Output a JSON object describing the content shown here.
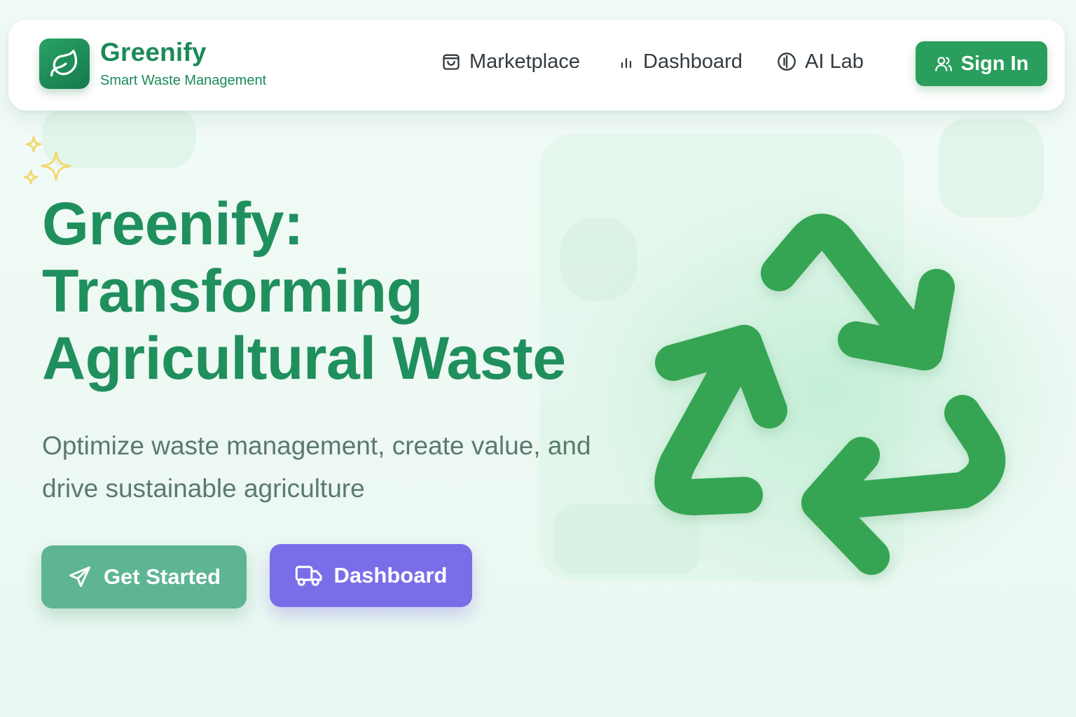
{
  "brand": {
    "name": "Greenify",
    "tagline": "Smart Waste Management",
    "logo_icon": "leaf-icon"
  },
  "nav": {
    "items": [
      {
        "label": "Marketplace",
        "icon": "shopping-bag-icon"
      },
      {
        "label": "Dashboard",
        "icon": "bar-chart-icon"
      },
      {
        "label": "AI Lab",
        "icon": "ai-circle-icon"
      }
    ],
    "signin": {
      "label": "Sign In",
      "icon": "users-icon"
    }
  },
  "hero": {
    "title_line1": "Greenify:",
    "title_line2": "Transforming",
    "title_line3": "Agricultural Waste",
    "subtitle_line1": "Optimize waste management, create value, and",
    "subtitle_line2": "drive sustainable agriculture",
    "primary_button": {
      "label": "Get Started",
      "icon": "send-icon"
    },
    "secondary_button": {
      "label": "Dashboard",
      "icon": "truck-icon"
    },
    "illustration": "recycle-icon",
    "decoration": "sparkles-icon"
  },
  "colors": {
    "brand_green": "#1c8a58",
    "signin_green": "#2a9e5c",
    "get_started": "#5db594",
    "dashboard_purple": "#7a6ee8",
    "recycle_green": "#36a553"
  }
}
